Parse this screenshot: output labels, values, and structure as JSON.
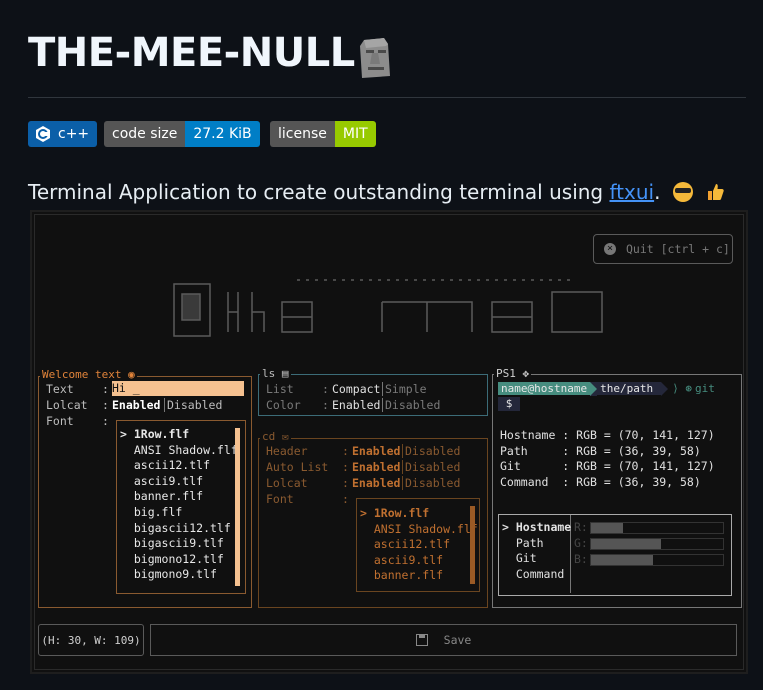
{
  "title": "THE-MEE-NULL",
  "badges": [
    {
      "label": "c++",
      "label_bg": "#0b5fa8"
    },
    {
      "label": "code size",
      "value": "27.2 KiB",
      "label_bg": "#555555",
      "value_bg": "#007ec6"
    },
    {
      "label": "license",
      "value": "MIT",
      "label_bg": "#555555",
      "value_bg": "#97ca00"
    }
  ],
  "intro": {
    "text": "Terminal Application to create outstanding terminal using ",
    "link": "ftxui",
    "tail": "."
  },
  "terminal": {
    "quit_label": "Quit [ctrl + c]",
    "welcome": {
      "title": "Welcome text",
      "text_label": "Text",
      "text_value": "Hi _",
      "lolcat_label": "Lolcat",
      "lolcat_on": "Enabled",
      "lolcat_off": "Disabled",
      "font_label": "Font",
      "fonts": [
        "> 1Row.flf",
        "  ANSI Shadow.flf",
        "  ascii12.tlf",
        "  ascii9.tlf",
        "  banner.flf",
        "  big.flf",
        "  bigascii12.tlf",
        "  bigascii9.tlf",
        "  bigmono12.tlf",
        "  bigmono9.tlf"
      ]
    },
    "ls": {
      "title": "ls",
      "list_label": "List",
      "list_on": "Compact",
      "list_off": "Simple",
      "color_label": "Color",
      "color_on": "Enabled",
      "color_off": "Disabled"
    },
    "cd": {
      "title": "cd",
      "header_label": "Header",
      "autolist_label": "Auto List",
      "lolcat_label": "Lolcat",
      "font_label": "Font",
      "on": "Enabled",
      "off": "Disabled",
      "fonts": [
        "> 1Row.flf",
        "  ANSI Shadow.flf",
        "  ascii12.tlf",
        "  ascii9.tlf",
        "  banner.flf"
      ]
    },
    "ps1": {
      "title": "PS1",
      "user": "name@hostname",
      "path": "the/path",
      "git": "git",
      "prompt": "$",
      "rows": [
        "Hostname : RGB = (70, 141, 127)",
        "Path     : RGB = (36, 39, 58)",
        "Git      : RGB = (70, 141, 127)",
        "Command  : RGB = (36, 39, 58)"
      ],
      "picker": [
        "> Hostname",
        "  Path",
        "  Git",
        "  Command"
      ],
      "picker_values": [
        "R:[",
        "G:[",
        "B:["
      ]
    },
    "status": "(H: 30, W: 109)",
    "save_label": "Save"
  }
}
